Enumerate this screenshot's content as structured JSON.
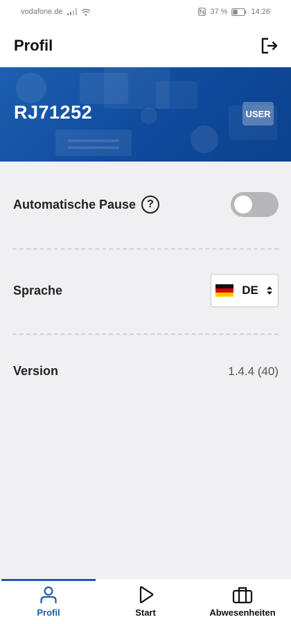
{
  "status_bar": {
    "carrier": "vodafone.de",
    "battery": "37 %",
    "time": "14:26",
    "icons": [
      "signal-icon",
      "wifi-icon",
      "nfc-icon",
      "battery-icon"
    ]
  },
  "app_bar": {
    "title": "Profil",
    "logout_icon": "logout-icon"
  },
  "banner": {
    "user_id": "RJ71252",
    "role_badge": "USER",
    "background_color": "#1459a8"
  },
  "settings": {
    "auto_pause": {
      "label": "Automatische Pause",
      "help_icon": "?",
      "enabled": false
    },
    "language": {
      "label": "Sprache",
      "selected": "DE",
      "flag": "germany-flag-icon"
    },
    "version": {
      "label": "Version",
      "value": "1.4.4 (40)"
    }
  },
  "bottom_nav": {
    "active": "Profil",
    "items": [
      {
        "label": "Profil",
        "icon": "person-icon"
      },
      {
        "label": "Start",
        "icon": "play-icon"
      },
      {
        "label": "Abwesenheiten",
        "icon": "suitcase-icon"
      }
    ]
  },
  "colors": {
    "accent": "#1b5ba8",
    "toggle_off": "#b7b7ba",
    "background": "#f0f0f3"
  }
}
